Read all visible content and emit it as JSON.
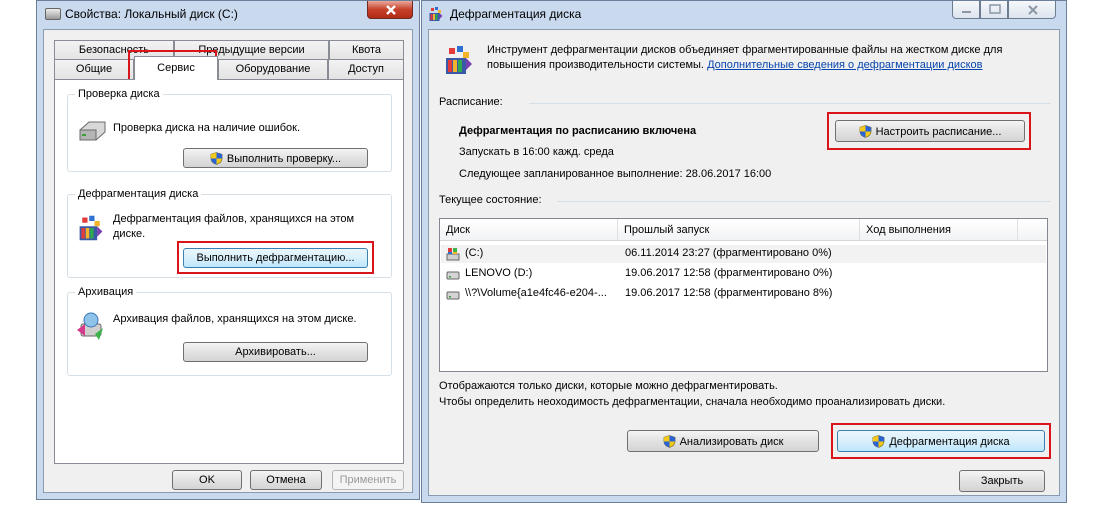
{
  "left_window": {
    "title": "Свойства: Локальный диск (C:)",
    "tabs_row1": [
      "Безопасность",
      "Предыдущие версии",
      "Квота"
    ],
    "tabs_row2": [
      "Общие",
      "Сервис",
      "Оборудование",
      "Доступ"
    ],
    "active_tab": "Сервис",
    "check": {
      "group": "Проверка диска",
      "text": "Проверка диска на наличие ошибок.",
      "button": "Выполнить проверку..."
    },
    "defrag": {
      "group": "Дефрагментация диска",
      "text_line1": "Дефрагментация файлов, хранящихся на этом",
      "text_line2": "диске.",
      "button": "Выполнить дефрагментацию..."
    },
    "backup": {
      "group": "Архивация",
      "text": "Архивация файлов, хранящихся на этом диске.",
      "button": "Архивировать..."
    },
    "footer": {
      "ok": "OK",
      "cancel": "Отмена",
      "apply": "Применить"
    }
  },
  "right_window": {
    "title": "Дефрагментация диска",
    "intro_line1": "Инструмент дефрагментации дисков объединяет фрагментированные файлы на жестком диске для",
    "intro_line2": "повышения производительности системы.",
    "intro_link": "Дополнительные сведения о дефрагментации дисков",
    "schedule": {
      "label": "Расписание:",
      "enabled": "Дефрагментация по расписанию включена",
      "run": "Запускать в 16:00 кажд. среда",
      "next": "Следующее запланированное выполнение: 28.06.2017 16:00",
      "button": "Настроить расписание..."
    },
    "status_label": "Текущее состояние:",
    "table": {
      "headers": [
        "Диск",
        "Прошлый запуск",
        "Ход выполнения"
      ],
      "rows": [
        {
          "disk": "(C:)",
          "last": "06.11.2014 23:27 (фрагментировано 0%)",
          "icon": "system-drive-icon"
        },
        {
          "disk": "LENOVO (D:)",
          "last": "19.06.2017 12:58 (фрагментировано 0%)",
          "icon": "drive-icon"
        },
        {
          "disk": "\\\\?\\Volume{a1e4fc46-e204-...",
          "last": "19.06.2017 12:58 (фрагментировано 8%)",
          "icon": "drive-icon"
        }
      ]
    },
    "note_line1": "Отображаются только диски, которые можно дефрагментировать.",
    "note_line2": "Чтобы определить неоходимость  дефрагментации, сначала необходимо проанализировать диски.",
    "analyze_button": "Анализировать диск",
    "defrag_button": "Дефрагментация диска",
    "close_button": "Закрыть"
  },
  "colors": {
    "highlight": "#d9141b",
    "link": "#0645ad",
    "selection": "#3399ff"
  }
}
